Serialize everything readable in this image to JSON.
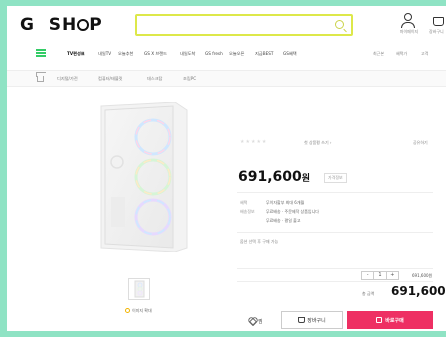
{
  "header": {
    "logo": "G  SH◌P",
    "search_placeholder": "",
    "user_label": "마이페이지",
    "cart_label": "장바구니"
  },
  "gnb": {
    "items": [
      "TV편성표",
      "내일TV",
      "오늘추천",
      "GS X 브랜드",
      "내일도착",
      "GS fresh",
      "오늘오픈",
      "지금BEST",
      "GS혜택"
    ],
    "right_items": [
      "최근본",
      "혜택가",
      "고객"
    ]
  },
  "breadcrumb": [
    "디지털/가전",
    "컴퓨터/태블릿",
    "데스크탑",
    "조립PC"
  ],
  "product": {
    "reviews_text": "첫 상품평 쓰기 ›",
    "share_text": "공유하기",
    "price_value": "691,600",
    "price_unit": "원",
    "price_badge": "가격정보",
    "info": [
      {
        "key": "혜택",
        "value": "무이자할부 최대 6개월"
      },
      {
        "key": "배송정보",
        "value": "무료배송 · 주문제작 상품입니다"
      },
      {
        "key": "",
        "value": "무료배송 · 평일 출고"
      }
    ],
    "option_label": "옵션 선택 후 구매 가능",
    "qty_minus": "-",
    "qty_value": "1",
    "qty_plus": "+",
    "row_price": "691,600원",
    "total_label": "총 금액",
    "total_price": "691,600",
    "zoom_label": "이미지 확대"
  },
  "actions": {
    "wish_label": "찜",
    "cart_label": "장바구니",
    "buy_label": "바로구매"
  },
  "colors": {
    "frame": "#8fe3c4",
    "search_border": "#dde84a",
    "accent_green": "#33cc66",
    "buy_button": "#ee2f63"
  }
}
